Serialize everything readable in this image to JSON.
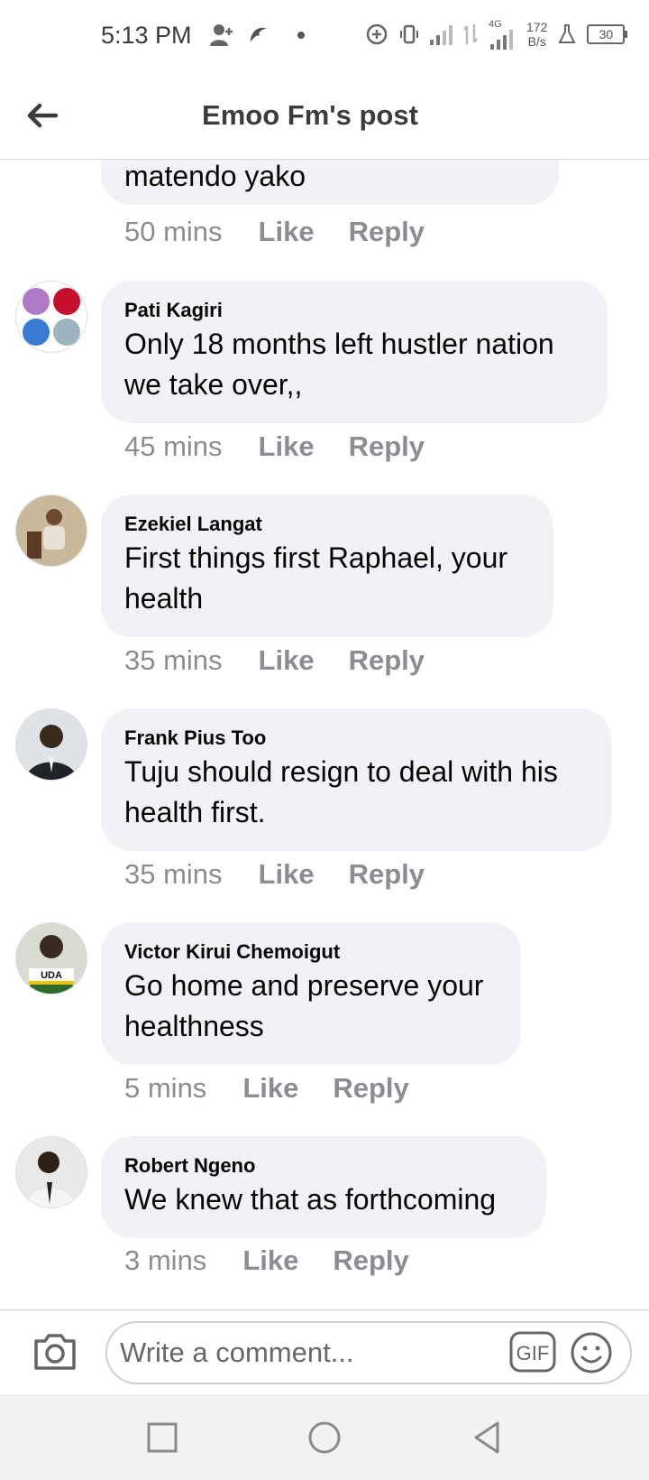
{
  "status_bar": {
    "time": "5:13 PM",
    "network": "4G",
    "speed_value": "172",
    "speed_unit": "B/s",
    "battery": "30"
  },
  "header": {
    "title": "Emoo Fm's post",
    "back_icon": "arrow-left-icon"
  },
  "top_partial_comment": {
    "text": "matendo yako",
    "time": "50 mins",
    "like": "Like",
    "reply": "Reply"
  },
  "comments": [
    {
      "author": "Pati Kagiri",
      "text": "Only 18 months left hustler nation we take over,,",
      "time": "45 mins",
      "like": "Like",
      "reply": "Reply"
    },
    {
      "author": "Ezekiel Langat",
      "text": "First things first Raphael, your health",
      "time": "35 mins",
      "like": "Like",
      "reply": "Reply"
    },
    {
      "author": "Frank Pius Too",
      "text": "Tuju should resign to deal with his health first.",
      "time": "35 mins",
      "like": "Like",
      "reply": "Reply"
    },
    {
      "author": "Victor Kirui Chemoigut",
      "text": "Go home and preserve your healthness",
      "time": "5 mins",
      "like": "Like",
      "reply": "Reply",
      "avatar_badge": "UDA"
    },
    {
      "author": "Robert Ngeno",
      "text": "We knew that as forthcoming",
      "time": "3 mins",
      "like": "Like",
      "reply": "Reply"
    }
  ],
  "composer": {
    "placeholder": "Write a comment...",
    "gif_label": "GIF",
    "camera_icon": "camera-icon",
    "emoji_icon": "smiley-icon"
  },
  "navbar": {
    "icons": [
      "square-recents-icon",
      "circle-home-icon",
      "triangle-back-icon"
    ]
  },
  "colors": {
    "bubble": "#f0f2f5",
    "meta_text": "#8a8d91",
    "header_text": "#3c3c3c"
  }
}
